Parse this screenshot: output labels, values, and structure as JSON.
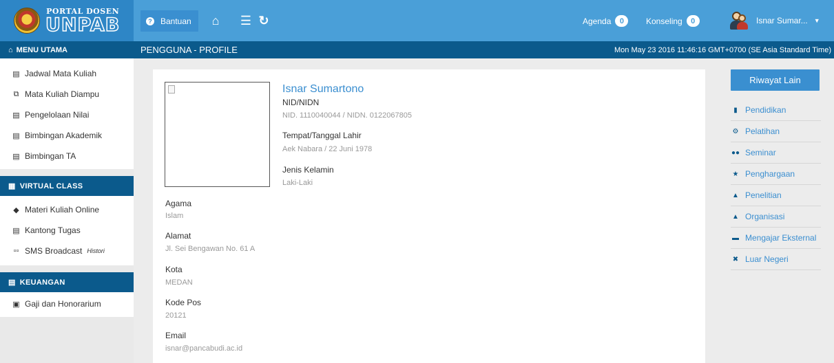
{
  "brand": {
    "small": "PORTAL DOSEN",
    "big": "UNPAB"
  },
  "topbar": {
    "help_label": "Bantuan",
    "agenda_label": "Agenda",
    "agenda_count": "0",
    "konseling_label": "Konseling",
    "konseling_count": "0",
    "user_name": "Isnar Sumar..."
  },
  "menubar": {
    "title": "MENU UTAMA",
    "page_title": "PENGGUNA - PROFILE",
    "datetime": "Mon May 23 2016 11:46:16 GMT+0700 (SE Asia Standard Time)"
  },
  "sidebar": {
    "main_items": [
      {
        "label": "Jadwal Mata Kuliah",
        "icon": "table-icon"
      },
      {
        "label": "Mata Kuliah Diampu",
        "icon": "copy-icon"
      },
      {
        "label": "Pengelolaan Nilai",
        "icon": "list-icon"
      },
      {
        "label": "Bimbingan Akademik",
        "icon": "list-icon"
      },
      {
        "label": "Bimbingan TA",
        "icon": "list-icon"
      }
    ],
    "virtual_title": "VIRTUAL CLASS",
    "virtual_items": [
      {
        "label": "Materi Kuliah Online",
        "icon": "tag-icon"
      },
      {
        "label": "Kantong Tugas",
        "icon": "list-icon"
      },
      {
        "label": "SMS Broadcast",
        "icon": "sms-icon",
        "extra": "Histori"
      }
    ],
    "keuangan_title": "KEUANGAN",
    "keuangan_items": [
      {
        "label": "Gaji dan Honorarium",
        "icon": "money-icon"
      }
    ]
  },
  "profile": {
    "name": "Isnar Sumartono",
    "nid_label": "NID/NIDN",
    "nid_value": "NID. 1110040044 / NIDN. 0122067805",
    "ttl_label": "Tempat/Tanggal Lahir",
    "ttl_value": "Aek Nabara / 22 Juni 1978",
    "jk_label": "Jenis Kelamin",
    "jk_value": "Laki-Laki",
    "agama_label": "Agama",
    "agama_value": "Islam",
    "alamat_label": "Alamat",
    "alamat_value": "Jl. Sei Bengawan No. 61 A",
    "kota_label": "Kota",
    "kota_value": "MEDAN",
    "kodepos_label": "Kode Pos",
    "kodepos_value": "20121",
    "email_label": "Email",
    "email_value": "isnar@pancabudi.ac.id"
  },
  "riwayat": {
    "button_label": "Riwayat Lain",
    "items": [
      {
        "label": "Pendidikan",
        "icon": "book-icon"
      },
      {
        "label": "Pelatihan",
        "icon": "cogs-icon"
      },
      {
        "label": "Seminar",
        "icon": "users-icon"
      },
      {
        "label": "Penghargaan",
        "icon": "star-icon"
      },
      {
        "label": "Penelitian",
        "icon": "flask-icon"
      },
      {
        "label": "Organisasi",
        "icon": "sitemap-icon"
      },
      {
        "label": "Mengajar Eksternal",
        "icon": "briefcase-icon"
      },
      {
        "label": "Luar Negeri",
        "icon": "plane-icon"
      }
    ]
  },
  "colors": {
    "topbar": "#4a9fd8",
    "brand_bg": "#2e86c6",
    "dark_bar": "#0b5a8c",
    "accent_button": "#3a8fd0",
    "link": "#3a8ed0"
  }
}
